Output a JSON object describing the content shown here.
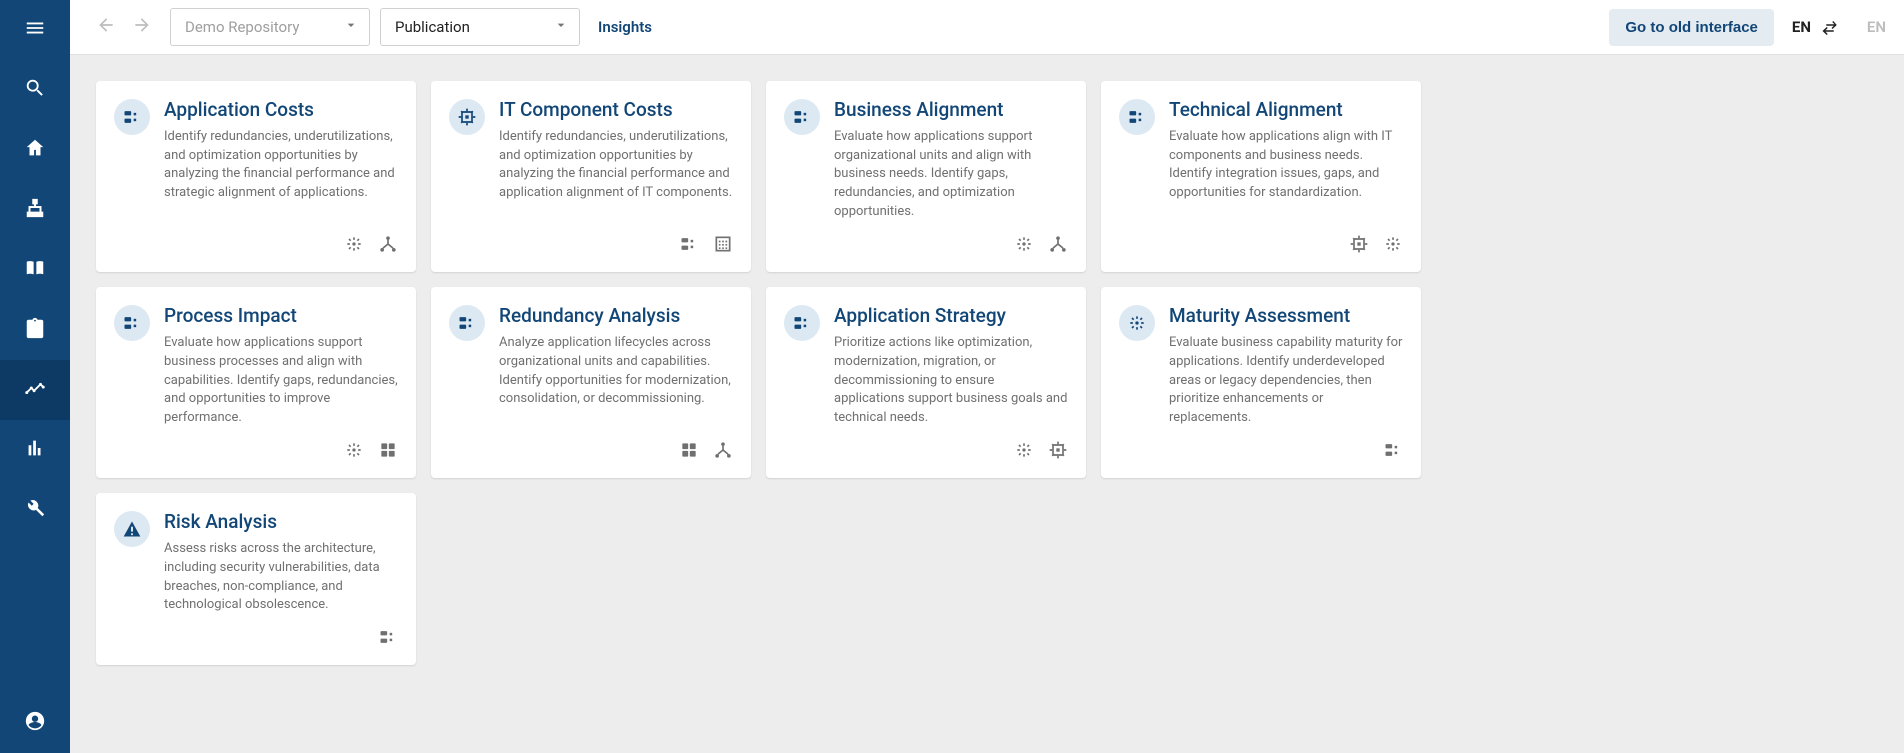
{
  "header": {
    "repository_label": "Demo Repository",
    "publication_label": "Publication",
    "insights_link": "Insights",
    "old_interface_btn": "Go to old interface",
    "lang_active": "EN",
    "lang_inactive": "EN"
  },
  "cards": [
    {
      "title": "Application Costs",
      "description": "Identify redundancies, underutilizations, and optimization opportunities by analyzing the financial performance and strategic alignment of applications.",
      "icon": "app",
      "tags": [
        "sparkle",
        "tree"
      ]
    },
    {
      "title": "IT Component Costs",
      "description": "Identify redundancies, underutilizations, and optimization opportunities by analyzing the financial performance and application alignment of IT components.",
      "icon": "chip",
      "tags": [
        "app",
        "building"
      ]
    },
    {
      "title": "Business Alignment",
      "description": "Evaluate how applications support organizational units and align with business needs. Identify gaps, redundancies, and optimization opportunities.",
      "icon": "app",
      "tags": [
        "sparkle",
        "tree"
      ]
    },
    {
      "title": "Technical Alignment",
      "description": "Evaluate how applications align with IT components and business needs. Identify integration issues, gaps, and opportunities for standardization.",
      "icon": "app",
      "tags": [
        "chip",
        "sparkle"
      ]
    },
    {
      "title": "Process Impact",
      "description": "Evaluate how applications support business processes and align with capabilities. Identify gaps, redundancies, and opportunities to improve performance.",
      "icon": "app",
      "tags": [
        "sparkle",
        "grid"
      ]
    },
    {
      "title": "Redundancy Analysis",
      "description": "Analyze application lifecycles across organizational units and capabilities. Identify opportunities for modernization, consolidation, or decommissioning.",
      "icon": "app",
      "tags": [
        "grid",
        "tree"
      ]
    },
    {
      "title": "Application Strategy",
      "description": "Prioritize actions like optimization, modernization, migration, or decommissioning to ensure applications support business goals and technical needs.",
      "icon": "app",
      "tags": [
        "sparkle",
        "chip"
      ]
    },
    {
      "title": "Maturity Assessment",
      "description": "Evaluate business capability maturity for applications. Identify underdeveloped areas or legacy dependencies, then prioritize enhancements or replacements.",
      "icon": "sparkle",
      "tags": [
        "app"
      ]
    },
    {
      "title": "Risk Analysis",
      "description": "Assess risks across the architecture, including security vulnerabilities, data breaches, non-compliance, and technological obsolescence.",
      "icon": "warning",
      "tags": [
        "app"
      ]
    }
  ]
}
